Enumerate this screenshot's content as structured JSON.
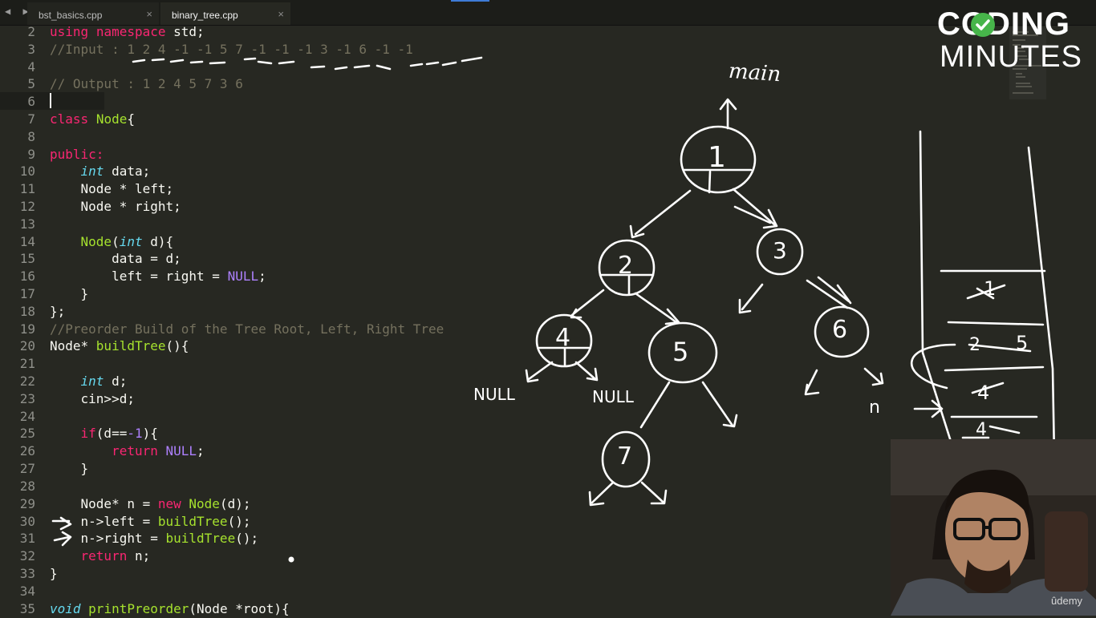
{
  "tabs": [
    {
      "label": "bst_basics.cpp",
      "close": "×"
    },
    {
      "label": "binary_tree.cpp",
      "close": "×"
    }
  ],
  "nav_arrows": "◀ ▶",
  "editor": {
    "line_numbers": [
      "2",
      "3",
      "4",
      "5",
      "6",
      "7",
      "8",
      "9",
      "10",
      "11",
      "12",
      "13",
      "14",
      "15",
      "16",
      "17",
      "18",
      "19",
      "20",
      "21",
      "22",
      "23",
      "24",
      "25",
      "26",
      "27",
      "28",
      "29",
      "30",
      "31",
      "32",
      "33",
      "34",
      "35"
    ],
    "lines": [
      "using namespace std;",
      "//Input : 1 2 4 -1 -1 5 7 -1 -1 -1 3 -1 6 -1 -1",
      "",
      "// Output : 1 2 4 5 7 3 6",
      "",
      "class Node{",
      "",
      "public:",
      "    int data;",
      "    Node * left;",
      "    Node * right;",
      "",
      "    Node(int d){",
      "        data = d;",
      "        left = right = NULL;",
      "    }",
      "};",
      "//Preorder Build of the Tree Root, Left, Right Tree",
      "Node* buildTree(){",
      "",
      "    int d;",
      "    cin>>d;",
      "",
      "    if(d==-1){",
      "        return NULL;",
      "    }",
      "",
      "    Node* n = new Node(d);",
      "    n->left = buildTree();",
      "    n->right = buildTree();",
      "    return n;",
      "}",
      "",
      "void printPreorder(Node *root){"
    ]
  },
  "annotations": {
    "main_label": "main",
    "null_left": "NULL",
    "null_right": "NULL",
    "n_label": "n",
    "tree_nodes": [
      "1",
      "2",
      "3",
      "4",
      "5",
      "6",
      "7"
    ],
    "stack_frames": [
      "1",
      "2",
      "5",
      "4",
      "4"
    ]
  },
  "logo": {
    "line1": "CODING",
    "line2": "MINUTES"
  },
  "watermark": "ûdemy",
  "colors": {
    "background": "#272822",
    "keyword": "#f92672",
    "type": "#66d9ef",
    "function": "#a6e22e",
    "comment": "#75715e",
    "constant": "#ae81ff",
    "logo_check": "#47b54a"
  }
}
